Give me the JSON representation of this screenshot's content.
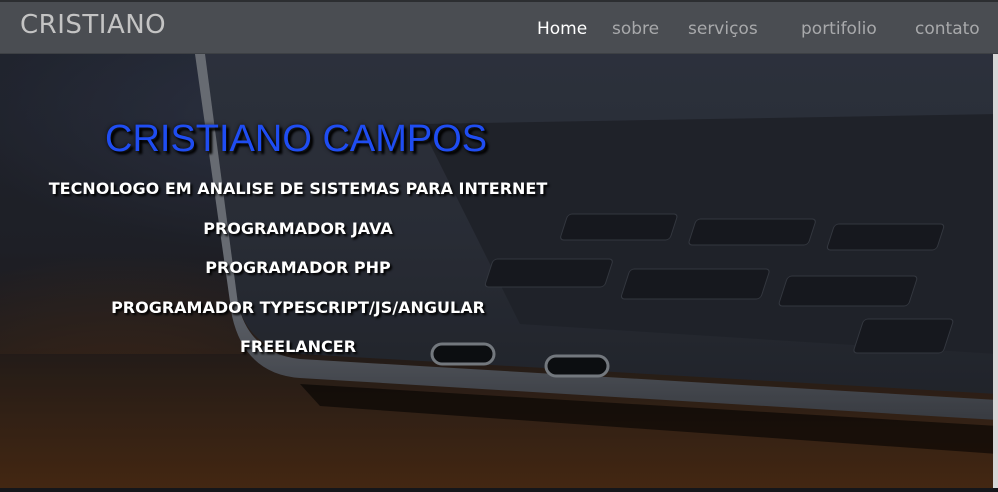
{
  "navbar": {
    "brand": "CRISTIANO",
    "links": [
      {
        "label": "Home",
        "active": true
      },
      {
        "label": "sobre",
        "active": false
      },
      {
        "label": "serviços",
        "active": false
      },
      {
        "label": "portifolio",
        "active": false
      },
      {
        "label": "contato",
        "active": false
      }
    ]
  },
  "hero": {
    "title": "CRISTIANO CAMPOS",
    "lines": [
      "TECNOLOGO EM ANALISE DE SISTEMAS PARA INTERNET",
      "PROGRAMADOR JAVA",
      "PROGRAMADOR PHP",
      "PROGRAMADOR TYPESCRIPT/JS/ANGULAR",
      "FREELANCER"
    ],
    "background": "laptop-photo"
  },
  "colors": {
    "navbar_bg": "#4a4d52",
    "nav_active": "#ffffff",
    "nav_inactive": "#a8a9ab",
    "title_blue": "#1f4df2"
  }
}
